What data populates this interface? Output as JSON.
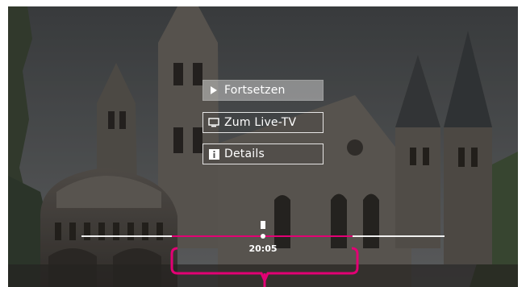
{
  "menu": {
    "items": [
      {
        "label": "Fortsetzen",
        "icon": "play-icon",
        "selected": true
      },
      {
        "label": "Zum Live-TV",
        "icon": "tv-icon",
        "selected": false
      },
      {
        "label": "Details",
        "icon": "info-icon",
        "selected": false
      }
    ]
  },
  "player": {
    "state": "paused",
    "current_time": "20:05",
    "progress": 0.5,
    "selection_start": 0.25,
    "selection_end": 0.75
  },
  "colors": {
    "accent": "#e20074",
    "text": "#ffffff",
    "selected_bg": "#c8c8c8"
  }
}
